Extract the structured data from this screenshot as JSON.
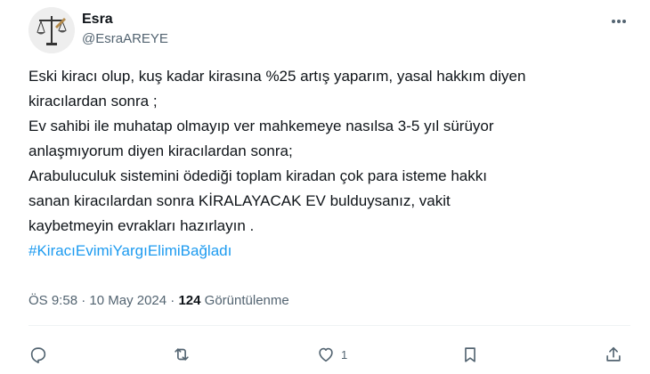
{
  "author": {
    "display_name": "Esra",
    "handle": "@EsraAREYE"
  },
  "tweet": {
    "lines": [
      "Eski kiracı olup, kuş kadar kirasına %25 artış yaparım, yasal hakkım diyen",
      "kiracılardan sonra ;",
      "Ev sahibi ile muhatap olmayıp ver mahkemeye nasılsa 3-5 yıl sürüyor",
      "anlaşmıyorum diyen kiracılardan sonra;",
      "Arabuluculuk sistemini ödediği toplam kiradan çok para isteme hakkı",
      "sanan kiracılardan sonra KİRALAYACAK EV bulduysanız, vakit",
      "kaybetmeyin evrakları hazırlayın ."
    ],
    "hashtag": "#KiracıEvimiYargıElimiBağladı"
  },
  "meta": {
    "time": "ÖS 9:58",
    "separator": "·",
    "date": "10 May 2024",
    "views_count": "124",
    "views_label": "Görüntülenme"
  },
  "actions": {
    "like_count": "1"
  },
  "icons": [
    "more-icon",
    "reply-icon",
    "retweet-icon",
    "like-icon",
    "bookmark-icon",
    "share-icon"
  ],
  "colors": {
    "text": "#0f1419",
    "secondary": "#536471",
    "accent": "#1d9bf0",
    "divider": "#eff3f4"
  }
}
